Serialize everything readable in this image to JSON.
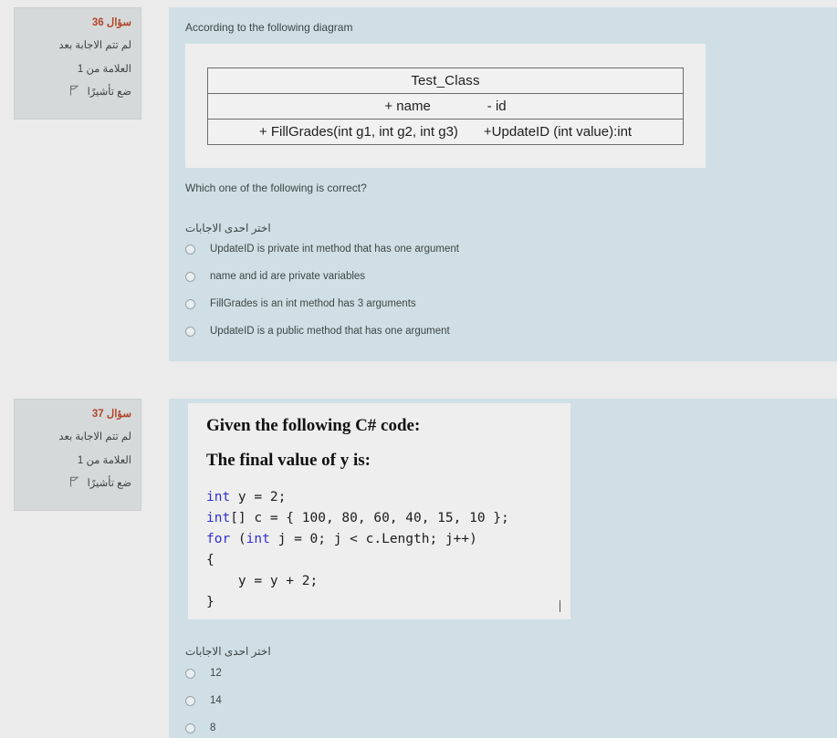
{
  "page": {
    "background": "#ebebeb",
    "panel_color": "#cfdfe5",
    "info_box_color": "#d6d9d9",
    "accent_color": "#b0452b"
  },
  "questions": [
    {
      "info": {
        "title": "سؤال 36",
        "status": "لم تتم الاجابة بعد",
        "mark": "العلامة من 1",
        "flag_label": "ضع تأشيرًا",
        "flag_icon": "flag-icon"
      },
      "intro": "According to the following diagram",
      "diagram": {
        "class_name": "Test_Class",
        "attributes": [
          "+ name",
          "- id"
        ],
        "methods": [
          "+ FillGrades(int g1, int g2, int g3)",
          "+UpdateID (int value):int"
        ]
      },
      "prompt": "Which one of the following is correct?",
      "answers_label": "اختر احدى الاجابات",
      "options": [
        "UpdateID is private int method that has one argument",
        "name and id are private variables",
        "FillGrades is an int method has 3 arguments",
        "UpdateID is a public method that has one argument"
      ]
    },
    {
      "info": {
        "title": "سؤال 37",
        "status": "لم تتم الاجابة بعد",
        "mark": "العلامة من 1",
        "flag_label": "ضع تأشيرًا",
        "flag_icon": "flag-icon"
      },
      "code_heading_1": "Given the following C# code:",
      "code_heading_2": "The final value of y is:",
      "code_lines": [
        {
          "tokens": [
            {
              "t": "int",
              "kw": true
            },
            {
              "t": " y = 2;",
              "kw": false
            }
          ]
        },
        {
          "tokens": [
            {
              "t": "int",
              "kw": true
            },
            {
              "t": "[] c = { 100, 80, 60, 40, 15, 10 };",
              "kw": false
            }
          ]
        },
        {
          "tokens": [
            {
              "t": "for",
              "kw": true
            },
            {
              "t": " (",
              "kw": false
            },
            {
              "t": "int",
              "kw": true
            },
            {
              "t": " j = 0; j < c.Length; j++)",
              "kw": false
            }
          ]
        },
        {
          "tokens": [
            {
              "t": "{",
              "kw": false
            }
          ]
        },
        {
          "tokens": [
            {
              "t": "    y = y + 2;",
              "kw": false
            }
          ]
        },
        {
          "tokens": [
            {
              "t": "}",
              "kw": false
            }
          ]
        }
      ],
      "answers_label": "اختر احدى الاجابات",
      "options": [
        "12",
        "14",
        "8"
      ]
    }
  ]
}
